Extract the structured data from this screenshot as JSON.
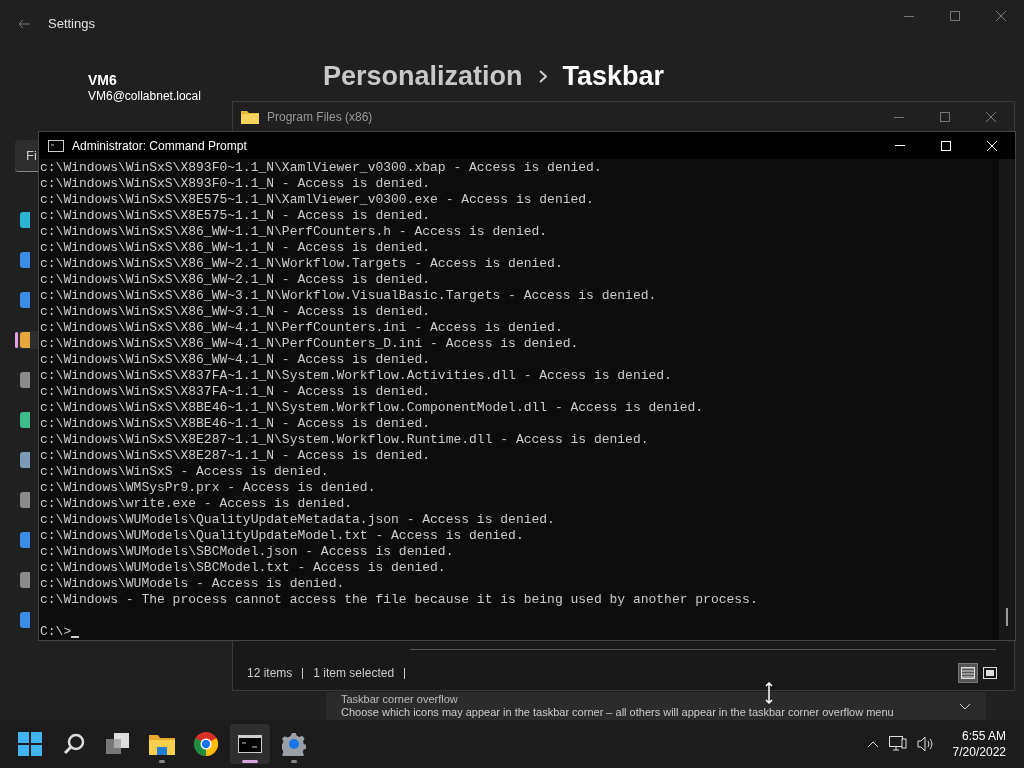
{
  "settings": {
    "title": "Settings",
    "user": {
      "name": "VM6",
      "email": "VM6@collabnet.local"
    },
    "breadcrumb": [
      "Personalization",
      "Taskbar"
    ],
    "search": {
      "value": "Fi"
    },
    "nav_items": [
      {
        "selected": false
      },
      {
        "selected": false
      },
      {
        "selected": false
      },
      {
        "selected": true
      },
      {
        "selected": false
      },
      {
        "selected": false
      },
      {
        "selected": false
      },
      {
        "selected": false
      },
      {
        "selected": false
      },
      {
        "selected": false
      },
      {
        "selected": false
      }
    ],
    "setting": {
      "title": "Taskbar corner overflow",
      "description": "Choose which icons may appear in the taskbar corner – all others will appear in the taskbar corner overflow menu",
      "expanded": false
    }
  },
  "explorer": {
    "title": "Program Files (x86)",
    "status": [
      "12 items",
      "1 item selected"
    ],
    "views": [
      {
        "kind": "details",
        "selected": true
      },
      {
        "kind": "tiles",
        "selected": false
      }
    ]
  },
  "cmd": {
    "title": "Administrator: Command Prompt",
    "lines": [
      "c:\\Windows\\WinSxS\\X893F0~1.1_N\\XamlViewer_v0300.xbap - Access is denied.",
      "c:\\Windows\\WinSxS\\X893F0~1.1_N - Access is denied.",
      "c:\\Windows\\WinSxS\\X8E575~1.1_N\\XamlViewer_v0300.exe - Access is denied.",
      "c:\\Windows\\WinSxS\\X8E575~1.1_N - Access is denied.",
      "c:\\Windows\\WinSxS\\X86_WW~1.1_N\\PerfCounters.h - Access is denied.",
      "c:\\Windows\\WinSxS\\X86_WW~1.1_N - Access is denied.",
      "c:\\Windows\\WinSxS\\X86_WW~2.1_N\\Workflow.Targets - Access is denied.",
      "c:\\Windows\\WinSxS\\X86_WW~2.1_N - Access is denied.",
      "c:\\Windows\\WinSxS\\X86_WW~3.1_N\\Workflow.VisualBasic.Targets - Access is denied.",
      "c:\\Windows\\WinSxS\\X86_WW~3.1_N - Access is denied.",
      "c:\\Windows\\WinSxS\\X86_WW~4.1_N\\PerfCounters.ini - Access is denied.",
      "c:\\Windows\\WinSxS\\X86_WW~4.1_N\\PerfCounters_D.ini - Access is denied.",
      "c:\\Windows\\WinSxS\\X86_WW~4.1_N - Access is denied.",
      "c:\\Windows\\WinSxS\\X837FA~1.1_N\\System.Workflow.Activities.dll - Access is denied.",
      "c:\\Windows\\WinSxS\\X837FA~1.1_N - Access is denied.",
      "c:\\Windows\\WinSxS\\X8BE46~1.1_N\\System.Workflow.ComponentModel.dll - Access is denied.",
      "c:\\Windows\\WinSxS\\X8BE46~1.1_N - Access is denied.",
      "c:\\Windows\\WinSxS\\X8E287~1.1_N\\System.Workflow.Runtime.dll - Access is denied.",
      "c:\\Windows\\WinSxS\\X8E287~1.1_N - Access is denied.",
      "c:\\Windows\\WinSxS - Access is denied.",
      "c:\\Windows\\WMSysPr9.prx - Access is denied.",
      "c:\\Windows\\write.exe - Access is denied.",
      "c:\\Windows\\WUModels\\QualityUpdateMetadata.json - Access is denied.",
      "c:\\Windows\\WUModels\\QualityUpdateModel.txt - Access is denied.",
      "c:\\Windows\\WUModels\\SBCModel.json - Access is denied.",
      "c:\\Windows\\WUModels\\SBCModel.txt - Access is denied.",
      "c:\\Windows\\WUModels - Access is denied.",
      "c:\\Windows - The process cannot access the file because it is being used by another process."
    ],
    "prompt": "C:\\>"
  },
  "taskbar": {
    "apps": [
      {
        "kind": "start",
        "running": false,
        "active": false
      },
      {
        "kind": "search",
        "running": false,
        "active": false
      },
      {
        "kind": "taskview",
        "running": false,
        "active": false
      },
      {
        "kind": "explorer",
        "running": true,
        "active": false
      },
      {
        "kind": "chrome",
        "running": false,
        "active": false
      },
      {
        "kind": "cmd",
        "running": true,
        "active": true
      },
      {
        "kind": "settings",
        "running": true,
        "active": false
      }
    ],
    "time": "6:55 AM",
    "date": "7/20/2022"
  }
}
